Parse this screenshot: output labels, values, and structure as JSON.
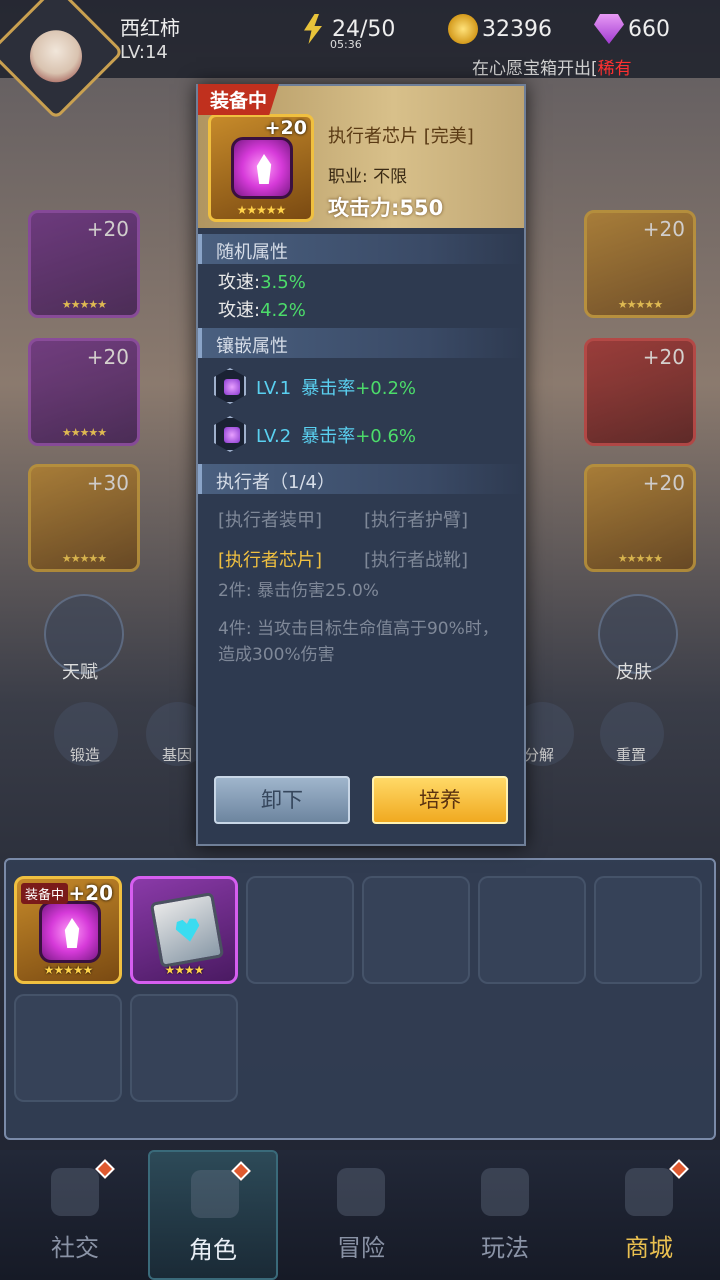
{
  "player": {
    "name": "西红柿",
    "level": "LV:14"
  },
  "resources": {
    "energy": "24/50",
    "energy_timer": "05:36",
    "gold": "32396",
    "gems": "660"
  },
  "marquee": {
    "text": "在心愿宝箱开出[",
    "highlight": "稀有"
  },
  "background_slots": [
    {
      "level": "+20"
    },
    {
      "level": "+20"
    },
    {
      "level": "+30"
    },
    {
      "level": "+20"
    },
    {
      "level": "+20"
    },
    {
      "level": "+20"
    }
  ],
  "side_buttons": {
    "talent": "天赋",
    "skin": "皮肤",
    "forge": "锻造",
    "gene": "基因",
    "decompose": "分解",
    "reset": "重置"
  },
  "popup": {
    "equipped_tag": "装备中",
    "item_level": "+20",
    "item_stars": "★★★★★",
    "item_name": "执行者芯片  [完美]",
    "job": "职业:  不限",
    "attack": "攻击力:550",
    "random_title": "随机属性",
    "random_attrs": [
      {
        "label": "攻速:",
        "value": "3.5%"
      },
      {
        "label": "攻速:",
        "value": "4.2%"
      }
    ],
    "inlay_title": "镶嵌属性",
    "inlays": [
      {
        "level": "LV.1",
        "stat": "暴击率",
        "value": "+0.2%"
      },
      {
        "level": "LV.2",
        "stat": "暴击率",
        "value": "+0.6%"
      }
    ],
    "set_title": "执行者（1/4）",
    "set_parts": [
      "[执行者装甲]",
      "[执行者护臂]",
      "[执行者芯片]",
      "[执行者战靴]"
    ],
    "set_bonus_2": "2件:  暴击伤害25.0%",
    "set_bonus_4": "4件:  当攻击目标生命值高于90%时，造成300%伤害",
    "unload_label": "卸下",
    "train_label": "培养"
  },
  "bag": {
    "items": [
      {
        "tag": "装备中",
        "level": "+20",
        "stars": "★★★★★",
        "rarity": "gold",
        "icon": "chip-icon"
      },
      {
        "stars": "★★★★",
        "rarity": "purple",
        "icon": "book-icon"
      }
    ]
  },
  "nav": {
    "social": "社交",
    "character": "角色",
    "adventure": "冒险",
    "play": "玩法",
    "shop": "商城"
  },
  "colors": {
    "accent_gold": "#f0c040",
    "green_value": "#4cdc6a",
    "cyan_value": "#5ad0f0",
    "equipped_red": "#c0301e"
  }
}
